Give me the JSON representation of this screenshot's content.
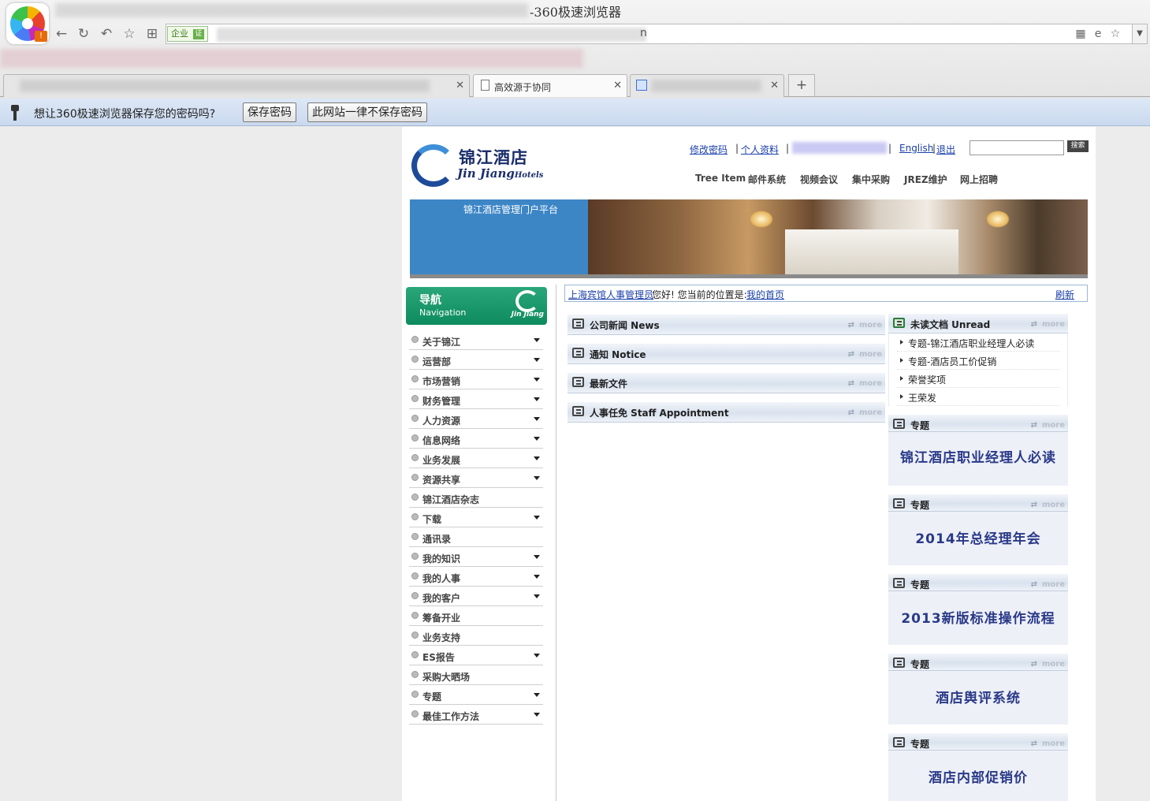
{
  "browser": {
    "window_title": "-360极速浏览器",
    "address": {
      "enterprise_label": "企业",
      "cert_label": "证",
      "url_tail": "n"
    },
    "tabs": [
      {
        "label": ""
      },
      {
        "label": "高效源于协同"
      },
      {
        "label": ""
      }
    ],
    "new_tab_label": "+",
    "password_bar": {
      "message": "想让360极速浏览器保存您的密码吗?",
      "save_label": "保存密码",
      "never_label": "此网站一律不保存密码"
    }
  },
  "site": {
    "brand_cn": "锦江酒店",
    "brand_en": "Jin Jiang",
    "brand_en_small": "Hotels",
    "toplinks": [
      "修改密码",
      "个人资料",
      "English",
      "退出"
    ],
    "search_label": "搜索",
    "menu": [
      "Tree Item",
      "邮件系统",
      "视频会议",
      "集中采购",
      "JREZ维护",
      "网上招聘"
    ],
    "banner_title": "锦江酒店管理门户平台",
    "nav": {
      "title_cn": "导航",
      "title_en": "Navigation",
      "mark_text": "Jin Jiang",
      "items": [
        {
          "label": "关于锦江",
          "expand": true
        },
        {
          "label": "运营部",
          "expand": true
        },
        {
          "label": "市场营销",
          "expand": true
        },
        {
          "label": "财务管理",
          "expand": true
        },
        {
          "label": "人力资源",
          "expand": true
        },
        {
          "label": "信息网络",
          "expand": true
        },
        {
          "label": "业务发展",
          "expand": true
        },
        {
          "label": "资源共享",
          "expand": true
        },
        {
          "label": "锦江酒店杂志",
          "expand": false
        },
        {
          "label": "下载",
          "expand": true
        },
        {
          "label": "通讯录",
          "expand": false
        },
        {
          "label": "我的知识",
          "expand": true
        },
        {
          "label": "我的人事",
          "expand": true
        },
        {
          "label": "我的客户",
          "expand": true
        },
        {
          "label": "筹备开业",
          "expand": false
        },
        {
          "label": "业务支持",
          "expand": false
        },
        {
          "label": "ES报告",
          "expand": true
        },
        {
          "label": "采购大晒场",
          "expand": false
        },
        {
          "label": "专题",
          "expand": true
        },
        {
          "label": "最佳工作方法",
          "expand": true
        }
      ]
    },
    "location": {
      "user": "上海宾馆人事管理员",
      "greeting": "您好! 您当前的位置是:",
      "home": "我的首页",
      "refresh": "刷新"
    },
    "more_label": "more",
    "sections": [
      {
        "title": "公司新闻 News"
      },
      {
        "title": "通知 Notice"
      },
      {
        "title": "最新文件"
      },
      {
        "title": "人事任免 Staff Appointment"
      }
    ],
    "unread": {
      "title": "未读文档 Unread",
      "items": [
        "专题-锦江酒店职业经理人必读",
        "专题-酒店员工价促销",
        "荣誉奖项",
        "王荣发"
      ]
    },
    "topics": [
      {
        "title": "专题",
        "text": "锦江酒店职业经理人必读"
      },
      {
        "title": "专题",
        "text": "2014年总经理年会"
      },
      {
        "title": "专题",
        "text": "2013新版标准操作流程"
      },
      {
        "title": "专题",
        "text": "酒店舆评系统"
      },
      {
        "title": "专题",
        "text": "酒店内部促销价"
      }
    ]
  }
}
